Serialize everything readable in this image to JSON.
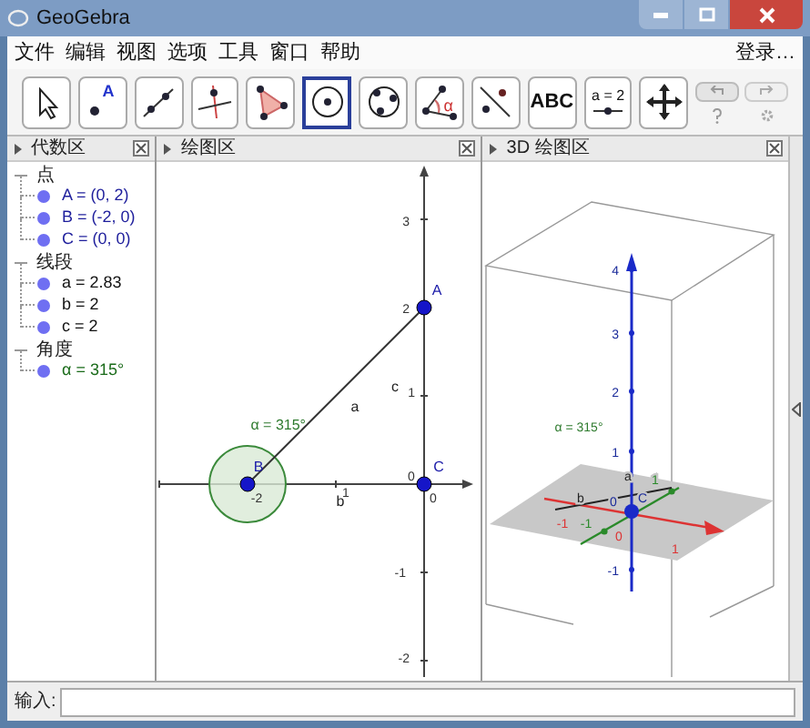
{
  "window": {
    "title": "GeoGebra"
  },
  "menu": [
    "文件",
    "编辑",
    "视图",
    "选项",
    "工具",
    "窗口",
    "帮助"
  ],
  "login": "登录…",
  "tools": [
    {
      "kind": "move",
      "selected": false
    },
    {
      "kind": "point",
      "label": "A",
      "selected": false
    },
    {
      "kind": "line",
      "selected": false
    },
    {
      "kind": "perpendicular",
      "selected": false
    },
    {
      "kind": "polygon",
      "selected": false
    },
    {
      "kind": "circle",
      "selected": true
    },
    {
      "kind": "circle3",
      "selected": false
    },
    {
      "kind": "angle",
      "label": "α",
      "selected": false
    },
    {
      "kind": "reflect",
      "selected": false
    },
    {
      "kind": "text",
      "label": "ABC",
      "selected": false
    },
    {
      "kind": "slider",
      "label": "a = 2",
      "selected": false
    },
    {
      "kind": "move_view",
      "selected": false
    }
  ],
  "panels": [
    {
      "title": "代数区"
    },
    {
      "title": "绘图区"
    },
    {
      "title": "3D 绘图区"
    }
  ],
  "algebra": [
    {
      "label": "点",
      "expanded": true,
      "children": [
        {
          "text": "A = (0, 2)",
          "color": "#1e1e9c"
        },
        {
          "text": "B = (-2, 0)",
          "color": "#1e1e9c"
        },
        {
          "text": "C = (0, 0)",
          "color": "#1e1e9c"
        }
      ]
    },
    {
      "label": "线段",
      "expanded": true,
      "children": [
        {
          "text": "a = 2.83",
          "color": "#111111"
        },
        {
          "text": "b = 2",
          "color": "#111111"
        },
        {
          "text": "c = 2",
          "color": "#111111"
        }
      ]
    },
    {
      "label": "角度",
      "expanded": true,
      "children": [
        {
          "text": "α = 315°",
          "color": "#1a6b1a"
        }
      ]
    }
  ],
  "graphics_2d": {
    "y_ticks": [
      "3",
      "2",
      "1",
      "-1",
      "-2"
    ],
    "x_ticks": [
      "-2",
      "1",
      "0"
    ],
    "origin_label": "0",
    "points": [
      {
        "label": "A"
      },
      {
        "label": "B"
      },
      {
        "label": "C"
      }
    ],
    "segment_labels": [
      "a",
      "b",
      "c"
    ],
    "angle_label": "α = 315°"
  },
  "graphics_3d": {
    "z_ticks": [
      "4",
      "3",
      "2",
      "1",
      "-1"
    ],
    "plane_labels": [
      "-1",
      "-1",
      "0",
      "0",
      "1",
      "1"
    ],
    "labels": [
      "a",
      "b",
      "C"
    ],
    "angle_label": "α = 315°"
  },
  "input_bar": {
    "label": "输入:"
  }
}
